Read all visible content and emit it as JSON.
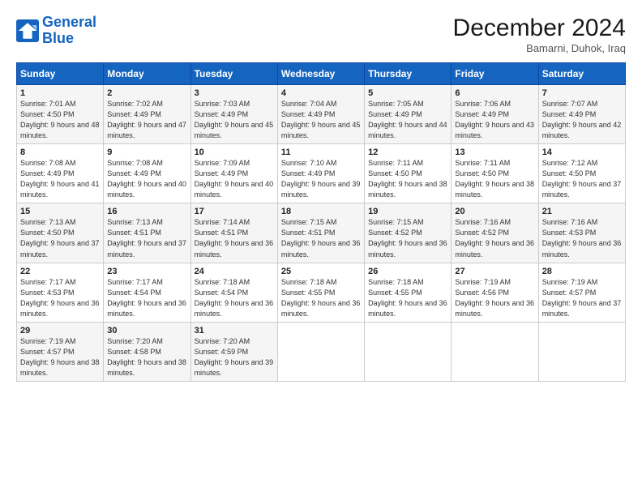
{
  "logo": {
    "line1": "General",
    "line2": "Blue"
  },
  "title": "December 2024",
  "subtitle": "Bamarni, Duhok, Iraq",
  "days_header": [
    "Sunday",
    "Monday",
    "Tuesday",
    "Wednesday",
    "Thursday",
    "Friday",
    "Saturday"
  ],
  "weeks": [
    [
      {
        "num": "1",
        "sunrise": "7:01 AM",
        "sunset": "4:50 PM",
        "daylight": "9 hours and 48 minutes."
      },
      {
        "num": "2",
        "sunrise": "7:02 AM",
        "sunset": "4:49 PM",
        "daylight": "9 hours and 47 minutes."
      },
      {
        "num": "3",
        "sunrise": "7:03 AM",
        "sunset": "4:49 PM",
        "daylight": "9 hours and 45 minutes."
      },
      {
        "num": "4",
        "sunrise": "7:04 AM",
        "sunset": "4:49 PM",
        "daylight": "9 hours and 45 minutes."
      },
      {
        "num": "5",
        "sunrise": "7:05 AM",
        "sunset": "4:49 PM",
        "daylight": "9 hours and 44 minutes."
      },
      {
        "num": "6",
        "sunrise": "7:06 AM",
        "sunset": "4:49 PM",
        "daylight": "9 hours and 43 minutes."
      },
      {
        "num": "7",
        "sunrise": "7:07 AM",
        "sunset": "4:49 PM",
        "daylight": "9 hours and 42 minutes."
      }
    ],
    [
      {
        "num": "8",
        "sunrise": "7:08 AM",
        "sunset": "4:49 PM",
        "daylight": "9 hours and 41 minutes."
      },
      {
        "num": "9",
        "sunrise": "7:08 AM",
        "sunset": "4:49 PM",
        "daylight": "9 hours and 40 minutes."
      },
      {
        "num": "10",
        "sunrise": "7:09 AM",
        "sunset": "4:49 PM",
        "daylight": "9 hours and 40 minutes."
      },
      {
        "num": "11",
        "sunrise": "7:10 AM",
        "sunset": "4:49 PM",
        "daylight": "9 hours and 39 minutes."
      },
      {
        "num": "12",
        "sunrise": "7:11 AM",
        "sunset": "4:50 PM",
        "daylight": "9 hours and 38 minutes."
      },
      {
        "num": "13",
        "sunrise": "7:11 AM",
        "sunset": "4:50 PM",
        "daylight": "9 hours and 38 minutes."
      },
      {
        "num": "14",
        "sunrise": "7:12 AM",
        "sunset": "4:50 PM",
        "daylight": "9 hours and 37 minutes."
      }
    ],
    [
      {
        "num": "15",
        "sunrise": "7:13 AM",
        "sunset": "4:50 PM",
        "daylight": "9 hours and 37 minutes."
      },
      {
        "num": "16",
        "sunrise": "7:13 AM",
        "sunset": "4:51 PM",
        "daylight": "9 hours and 37 minutes."
      },
      {
        "num": "17",
        "sunrise": "7:14 AM",
        "sunset": "4:51 PM",
        "daylight": "9 hours and 36 minutes."
      },
      {
        "num": "18",
        "sunrise": "7:15 AM",
        "sunset": "4:51 PM",
        "daylight": "9 hours and 36 minutes."
      },
      {
        "num": "19",
        "sunrise": "7:15 AM",
        "sunset": "4:52 PM",
        "daylight": "9 hours and 36 minutes."
      },
      {
        "num": "20",
        "sunrise": "7:16 AM",
        "sunset": "4:52 PM",
        "daylight": "9 hours and 36 minutes."
      },
      {
        "num": "21",
        "sunrise": "7:16 AM",
        "sunset": "4:53 PM",
        "daylight": "9 hours and 36 minutes."
      }
    ],
    [
      {
        "num": "22",
        "sunrise": "7:17 AM",
        "sunset": "4:53 PM",
        "daylight": "9 hours and 36 minutes."
      },
      {
        "num": "23",
        "sunrise": "7:17 AM",
        "sunset": "4:54 PM",
        "daylight": "9 hours and 36 minutes."
      },
      {
        "num": "24",
        "sunrise": "7:18 AM",
        "sunset": "4:54 PM",
        "daylight": "9 hours and 36 minutes."
      },
      {
        "num": "25",
        "sunrise": "7:18 AM",
        "sunset": "4:55 PM",
        "daylight": "9 hours and 36 minutes."
      },
      {
        "num": "26",
        "sunrise": "7:18 AM",
        "sunset": "4:55 PM",
        "daylight": "9 hours and 36 minutes."
      },
      {
        "num": "27",
        "sunrise": "7:19 AM",
        "sunset": "4:56 PM",
        "daylight": "9 hours and 36 minutes."
      },
      {
        "num": "28",
        "sunrise": "7:19 AM",
        "sunset": "4:57 PM",
        "daylight": "9 hours and 37 minutes."
      }
    ],
    [
      {
        "num": "29",
        "sunrise": "7:19 AM",
        "sunset": "4:57 PM",
        "daylight": "9 hours and 38 minutes."
      },
      {
        "num": "30",
        "sunrise": "7:20 AM",
        "sunset": "4:58 PM",
        "daylight": "9 hours and 38 minutes."
      },
      {
        "num": "31",
        "sunrise": "7:20 AM",
        "sunset": "4:59 PM",
        "daylight": "9 hours and 39 minutes."
      },
      null,
      null,
      null,
      null
    ]
  ],
  "labels": {
    "sunrise": "Sunrise:",
    "sunset": "Sunset:",
    "daylight": "Daylight:"
  }
}
